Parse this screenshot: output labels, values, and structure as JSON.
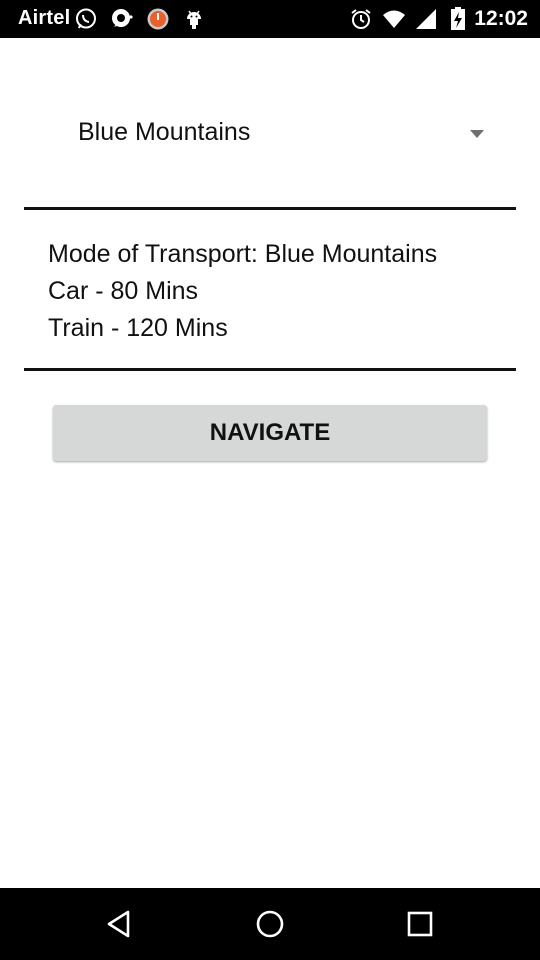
{
  "status_bar": {
    "carrier": "Airtel",
    "time": "12:02",
    "icons": [
      "whatsapp-icon",
      "chat-bubble-icon",
      "power-app-icon",
      "android-icon",
      "alarm-icon",
      "wifi-icon",
      "signal-icon",
      "battery-charging-icon"
    ]
  },
  "spinner": {
    "selected_value": "Blue Mountains",
    "arrow_icon": "dropdown-arrow-icon"
  },
  "info": {
    "line1": "Mode of Transport: Blue Mountains",
    "line2": "Car - 80 Mins",
    "line3": "Train - 120 Mins"
  },
  "navigate_button": {
    "label": "NAVIGATE"
  },
  "nav_bar": {
    "icons": [
      "back-icon",
      "home-icon",
      "recents-icon"
    ]
  },
  "colors": {
    "background": "#ffffff",
    "bars": "#000000",
    "button": "#d6d7d7",
    "text": "#111111"
  }
}
